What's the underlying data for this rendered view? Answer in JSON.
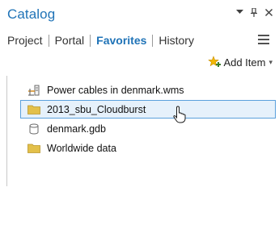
{
  "panel": {
    "title": "Catalog",
    "controls": [
      {
        "name": "options-dropdown",
        "glyph": "▾"
      },
      {
        "name": "pin",
        "glyph": "⊥"
      },
      {
        "name": "close",
        "glyph": "✕"
      }
    ]
  },
  "tabs": [
    {
      "label": "Project",
      "active": false
    },
    {
      "label": "Portal",
      "active": false
    },
    {
      "label": "Favorites",
      "active": true
    },
    {
      "label": "History",
      "active": false
    }
  ],
  "toolbar": {
    "add_item_label": "Add Item",
    "add_item_chevron": "▾"
  },
  "items": [
    {
      "label": "Power cables in denmark.wms",
      "icon": "wms-server-icon",
      "selected": false
    },
    {
      "label": "2013_sbu_Cloudburst",
      "icon": "folder-icon",
      "selected": true
    },
    {
      "label": "denmark.gdb",
      "icon": "database-icon",
      "selected": false
    },
    {
      "label": "Worldwide data",
      "icon": "folder-icon",
      "selected": false
    }
  ],
  "colors": {
    "accent": "#1f73b7",
    "selection_bg": "#e6f1fb",
    "selection_border": "#5aa0dc",
    "folder": "#e3c04a"
  }
}
